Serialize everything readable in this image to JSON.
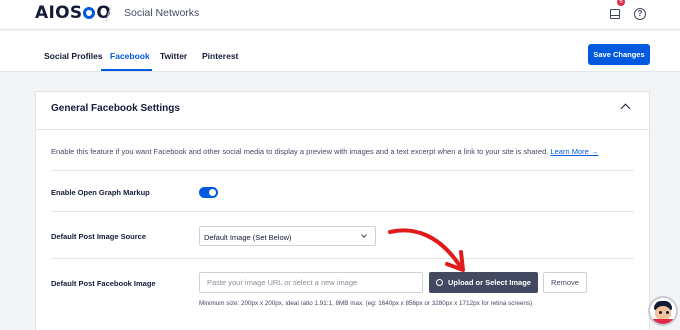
{
  "header": {
    "logo_text_left": "AIOS",
    "logo_text_right": "O",
    "breadcrumb": "Social Networks",
    "notification_count": "6"
  },
  "tabs": [
    {
      "label": "Social Profiles",
      "active": false
    },
    {
      "label": "Facebook",
      "active": true
    },
    {
      "label": "Twitter",
      "active": false
    },
    {
      "label": "Pinterest",
      "active": false
    }
  ],
  "toolbar": {
    "save_label": "Save Changes"
  },
  "settings": {
    "title": "General Facebook Settings",
    "description": "Enable this feature if you want Facebook and other social media to display a preview with images and a text excerpt when a link to your site is shared.",
    "learn_more": "Learn More →",
    "open_graph": {
      "label": "Enable Open Graph Markup",
      "enabled": true
    },
    "image_source": {
      "label": "Default Post Image Source",
      "selected": "Default Image (Set Below)"
    },
    "facebook_image": {
      "label": "Default Post Facebook Image",
      "placeholder": "Paste your image URL or select a new image",
      "value": "",
      "upload_label": "Upload or Select Image",
      "remove_label": "Remove",
      "hint": "Minimum size: 200px x 200px, ideal ratio 1.91:1, 8MB max. (eg: 1640px x 856px or 3280px x 1712px for retina screens)"
    }
  },
  "colors": {
    "accent": "#005ae0",
    "dark_button": "#434960",
    "badge": "#df2a4a",
    "annotation_arrow": "#e11b1b"
  },
  "icons": {
    "notifications": "inbox-icon",
    "help": "help-icon",
    "collapse": "chevron-up-icon",
    "upload": "upload-icon",
    "dropdown": "chevron-down-icon"
  }
}
